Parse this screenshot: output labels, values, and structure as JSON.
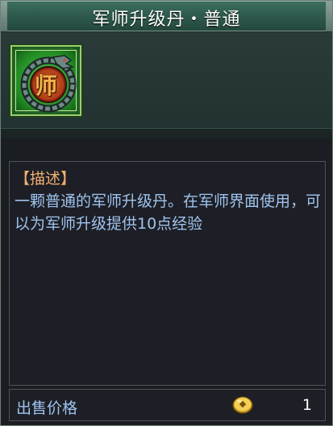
{
  "title": "军师升级丹・普通",
  "item": {
    "icon": "military-advisor-badge-icon",
    "icon_char": "师",
    "quality_color": "#2c7a2f"
  },
  "description": {
    "heading": "【描述】",
    "body": "一颗普通的军师升级丹。在军师界面使用，可以为军师升级提供10点经验"
  },
  "sell": {
    "label": "出售价格",
    "currency_icon": "gold-coin-icon",
    "price": "1"
  },
  "colors": {
    "title_bar": "#2f5c4f",
    "heading_text": "#f0b070",
    "body_text": "#9fc3ee"
  }
}
